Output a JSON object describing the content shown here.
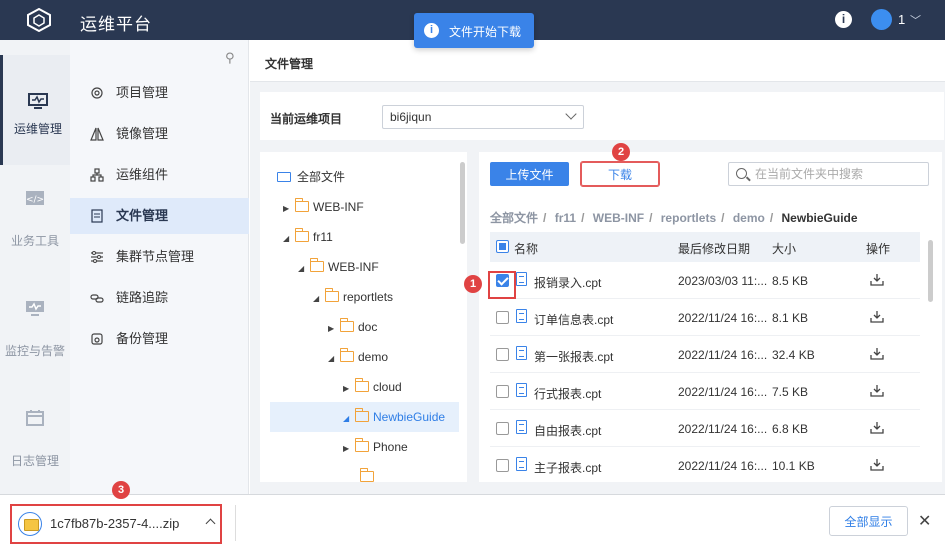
{
  "app": {
    "title": "运维平台",
    "user_label": "1"
  },
  "toast": {
    "text": "文件开始下载"
  },
  "left_nav": [
    {
      "label": "运维管理",
      "icon": "monitor-icon",
      "active": true
    },
    {
      "label": "业务工具",
      "icon": "code-icon",
      "active": false
    },
    {
      "label": "监控与告警",
      "icon": "pulse-monitor-icon",
      "active": false
    },
    {
      "label": "日志管理",
      "icon": "calendar-icon",
      "active": false
    }
  ],
  "sub_menu": [
    {
      "label": "项目管理",
      "icon": "gear-icon"
    },
    {
      "label": "镜像管理",
      "icon": "mirror-icon"
    },
    {
      "label": "运维组件",
      "icon": "component-icon"
    },
    {
      "label": "文件管理",
      "icon": "document-icon",
      "active": true
    },
    {
      "label": "集群节点管理",
      "icon": "sliders-icon"
    },
    {
      "label": "链路追踪",
      "icon": "link-icon"
    },
    {
      "label": "备份管理",
      "icon": "backup-icon"
    }
  ],
  "page": {
    "title": "文件管理"
  },
  "project": {
    "label": "当前运维项目",
    "value": "bi6jiqun"
  },
  "tree": [
    {
      "label": "全部文件",
      "arrow": "",
      "icon": "monitor"
    },
    {
      "label": "WEB-INF",
      "arrow": "▶",
      "icon": "folder"
    },
    {
      "label": "fr11",
      "arrow": "◢",
      "icon": "folder"
    },
    {
      "label": "WEB-INF",
      "arrow": "◢",
      "icon": "folder"
    },
    {
      "label": "reportlets",
      "arrow": "◢",
      "icon": "folder"
    },
    {
      "label": "doc",
      "arrow": "▶",
      "icon": "folder"
    },
    {
      "label": "demo",
      "arrow": "◢",
      "icon": "folder"
    },
    {
      "label": "cloud",
      "arrow": "▶",
      "icon": "folder"
    },
    {
      "label": "NewbieGuide",
      "arrow": "◢",
      "icon": "folder",
      "selected": true
    },
    {
      "label": "Phone",
      "arrow": "▶",
      "icon": "folder"
    }
  ],
  "toolbar": {
    "upload_label": "上传文件",
    "download_label": "下载",
    "search_placeholder": "在当前文件夹中搜索"
  },
  "breadcrumb": [
    "全部文件",
    "fr11",
    "WEB-INF",
    "reportlets",
    "demo",
    "NewbieGuide"
  ],
  "table": {
    "headers": {
      "name": "名称",
      "modified": "最后修改日期",
      "size": "大小",
      "action": "操作"
    },
    "rows": [
      {
        "name": "报销录入.cpt",
        "modified": "2023/03/03 11:...",
        "size": "8.5 KB",
        "checked": true
      },
      {
        "name": "订单信息表.cpt",
        "modified": "2022/11/24 16:...",
        "size": "8.1 KB",
        "checked": false
      },
      {
        "name": "第一张报表.cpt",
        "modified": "2022/11/24 16:...",
        "size": "32.4 KB",
        "checked": false
      },
      {
        "name": "行式报表.cpt",
        "modified": "2022/11/24 16:...",
        "size": "7.5 KB",
        "checked": false
      },
      {
        "name": "自由报表.cpt",
        "modified": "2022/11/24 16:...",
        "size": "6.8 KB",
        "checked": false
      },
      {
        "name": "主子报表.cpt",
        "modified": "2022/11/24 16:...",
        "size": "10.1 KB",
        "checked": false
      }
    ]
  },
  "annotations": [
    "1",
    "2",
    "3"
  ],
  "download_bar": {
    "filename": "1c7fb87b-2357-4....zip",
    "show_all_label": "全部显示"
  },
  "colors": {
    "topbar": "#2a3852",
    "accent": "#3a83e8",
    "annotation": "#e04343",
    "folder": "#f2a33a"
  }
}
